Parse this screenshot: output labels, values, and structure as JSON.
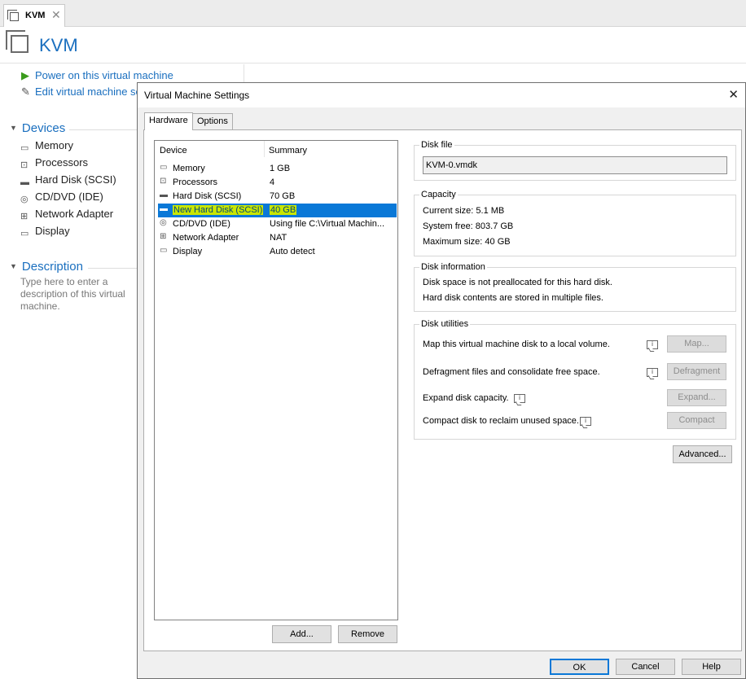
{
  "app_tab": {
    "label": "KVM",
    "close": "✕"
  },
  "vm": {
    "title": "KVM"
  },
  "actions": {
    "power_on": "Power on this virtual machine",
    "edit_settings": "Edit virtual machine settings"
  },
  "sidebar": {
    "devices_header": "Devices",
    "devices": [
      {
        "label": "Memory",
        "icon": "memory-icon"
      },
      {
        "label": "Processors",
        "icon": "processor-icon"
      },
      {
        "label": "Hard Disk (SCSI)",
        "icon": "hard-disk-icon"
      },
      {
        "label": "CD/DVD (IDE)",
        "icon": "cd-dvd-icon"
      },
      {
        "label": "Network Adapter",
        "icon": "network-adapter-icon"
      },
      {
        "label": "Display",
        "icon": "display-icon"
      }
    ],
    "description_header": "Description",
    "description_placeholder": "Type here to enter a description of this virtual machine."
  },
  "dialog": {
    "title": "Virtual Machine Settings",
    "close": "✕",
    "tabs": [
      "Hardware",
      "Options"
    ],
    "device_list": {
      "col_device": "Device",
      "col_summary": "Summary",
      "rows": [
        {
          "device": "Memory",
          "summary": "1 GB"
        },
        {
          "device": "Processors",
          "summary": "4"
        },
        {
          "device": "Hard Disk (SCSI)",
          "summary": "70 GB"
        },
        {
          "device": "New Hard Disk (SCSI)",
          "summary": "40 GB"
        },
        {
          "device": "CD/DVD (IDE)",
          "summary": "Using file C:\\Virtual Machin..."
        },
        {
          "device": "Network Adapter",
          "summary": "NAT"
        },
        {
          "device": "Display",
          "summary": "Auto detect"
        }
      ],
      "selected_index": 3
    },
    "add_button": "Add...",
    "remove_button": "Remove",
    "disk_file": {
      "title": "Disk file",
      "value": "KVM-0.vmdk"
    },
    "capacity": {
      "title": "Capacity",
      "current_size": "Current size:  5.1 MB",
      "system_free": "System free:  803.7 GB",
      "maximum_size": "Maximum size:  40 GB"
    },
    "disk_information": {
      "title": "Disk information",
      "line1": "Disk space is not preallocated for this hard disk.",
      "line2": "Hard disk contents are stored in multiple files."
    },
    "disk_utilities": {
      "title": "Disk utilities",
      "map_text": "Map this virtual machine disk to a local volume.",
      "map_button": "Map...",
      "defrag_text": "Defragment files and consolidate free space.",
      "defrag_button": "Defragment",
      "expand_text": "Expand disk capacity.",
      "expand_button": "Expand...",
      "compact_text": "Compact disk to reclaim unused space.",
      "compact_button": "Compact"
    },
    "advanced_button": "Advanced...",
    "ok_button": "OK",
    "cancel_button": "Cancel",
    "help_button": "Help"
  }
}
